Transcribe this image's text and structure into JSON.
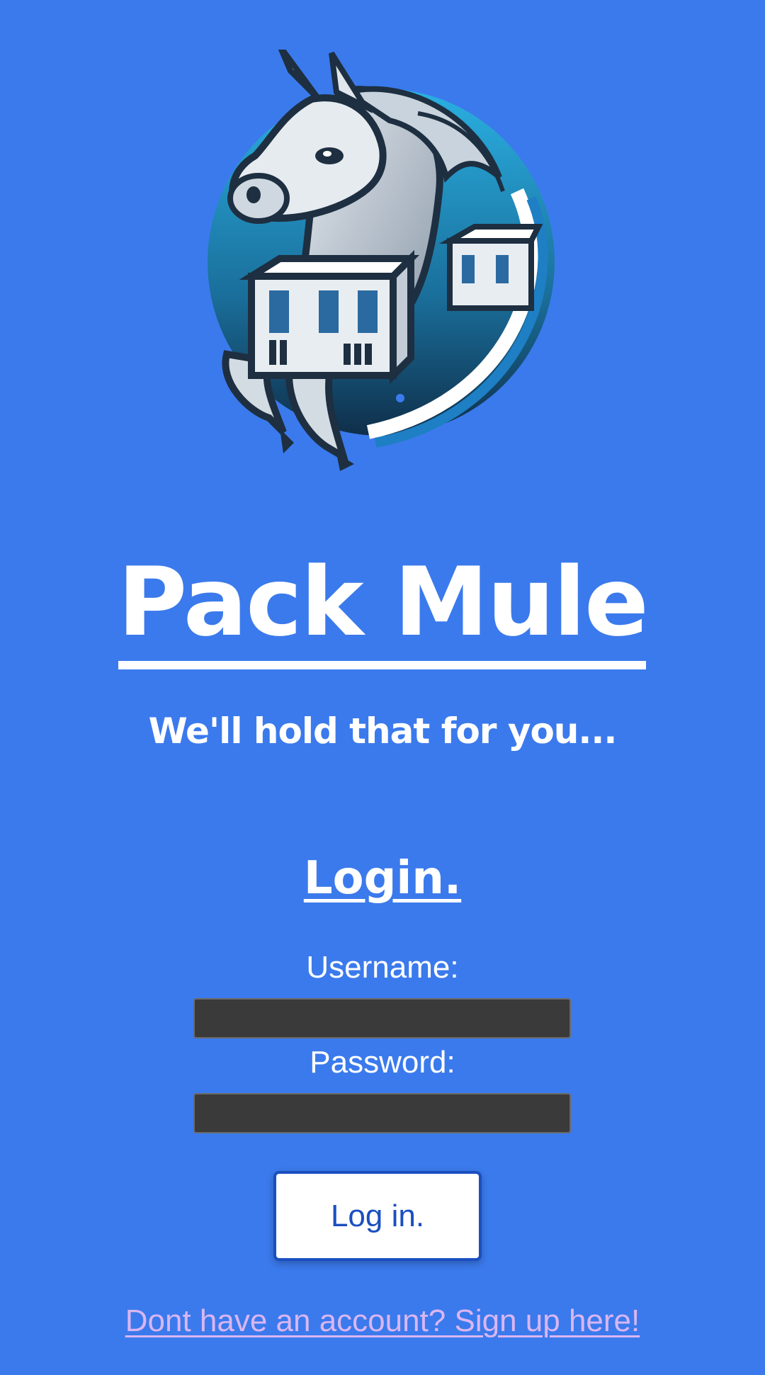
{
  "app": {
    "title": "Pack Mule",
    "tagline": "We'll hold that for you..."
  },
  "logo": {
    "icon": "pack-mule-logo"
  },
  "login": {
    "heading": "Login.",
    "username_label": "Username:",
    "username_value": "",
    "password_label": "Password:",
    "password_value": "",
    "submit_label": "Log in.",
    "signup_link": "Dont have an account? Sign up here!"
  },
  "colors": {
    "background": "#3b7aec",
    "input_background": "#3a3a3a",
    "button_text": "#1a4fc0",
    "link": "#d9b6f2"
  }
}
